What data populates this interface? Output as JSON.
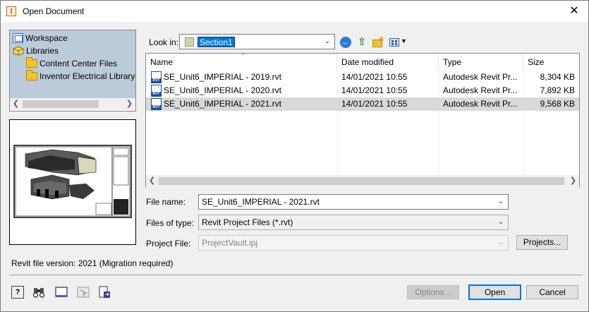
{
  "window": {
    "title": "Open Document",
    "close_glyph": "✕"
  },
  "places": {
    "items": [
      {
        "label": "Workspace",
        "icon": "workspace-icon"
      },
      {
        "label": "Libraries",
        "icon": "libraries-icon"
      },
      {
        "label": "Content Center Files",
        "icon": "folder-icon"
      },
      {
        "label": "Inventor Electrical Library",
        "icon": "folder-icon"
      }
    ]
  },
  "lookin": {
    "label": "Look in:",
    "value": "Section1"
  },
  "columns": {
    "name": "Name",
    "date": "Date modified",
    "type": "Type",
    "size": "Size"
  },
  "files": [
    {
      "name": "SE_Unit6_IMPERIAL - 2019.rvt",
      "date": "14/01/2021 10:55",
      "type": "Autodesk Revit Pr...",
      "size": "8,304 KB"
    },
    {
      "name": "SE_Unit6_IMPERIAL - 2020.rvt",
      "date": "14/01/2021 10:55",
      "type": "Autodesk Revit Pr...",
      "size": "7,892 KB"
    },
    {
      "name": "SE_Unit6_IMPERIAL - 2021.rvt",
      "date": "14/01/2021 10:55",
      "type": "Autodesk Revit Pr...",
      "size": "9,568 KB",
      "selected": true
    }
  ],
  "form": {
    "filename_label": "File name:",
    "filename_value": "SE_Unit6_IMPERIAL - 2021.rvt",
    "filetype_label": "Files of type:",
    "filetype_value": "Revit Project Files (*.rvt)",
    "project_label": "Project File:",
    "project_value": "ProjectVault.ipj",
    "projects_button": "Projects..."
  },
  "version_text": "Revit file version: 2021 (Migration required)",
  "buttons": {
    "options": "Options...",
    "open": "Open",
    "cancel": "Cancel"
  },
  "bottom_tools": [
    "help-icon",
    "find-icon",
    "preview-icon",
    "options-icon",
    "export-icon"
  ]
}
